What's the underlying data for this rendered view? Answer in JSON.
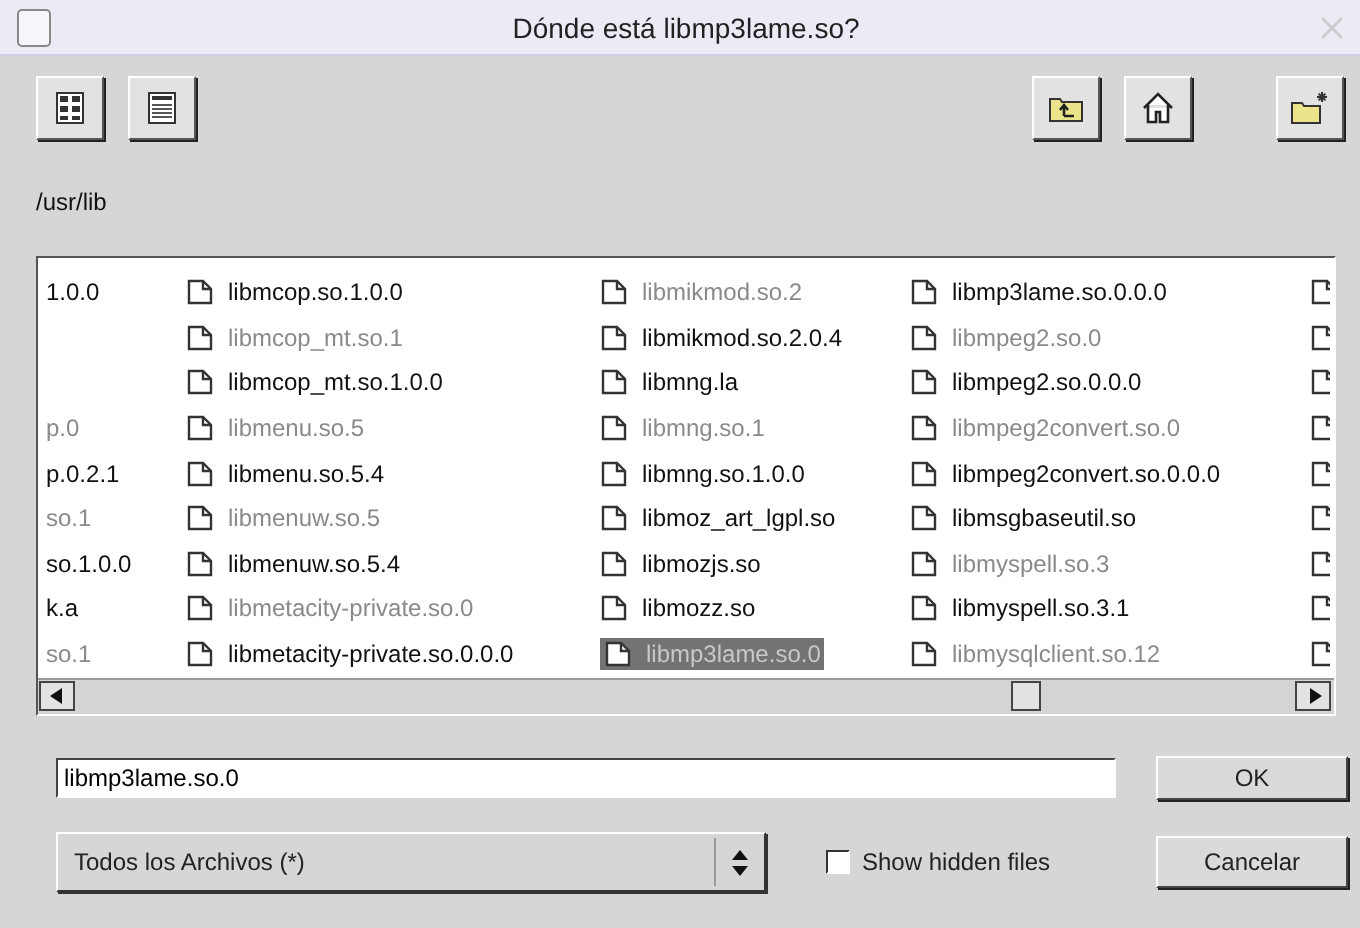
{
  "window": {
    "title": "Dónde está libmp3lame.so?"
  },
  "path": "/usr/lib",
  "file_columns": [
    {
      "items": [
        {
          "kind": "partial",
          "name": "1.0.0",
          "dim": false
        },
        {
          "kind": "blank"
        },
        {
          "kind": "blank"
        },
        {
          "kind": "partial",
          "name": "p.0",
          "dim": true
        },
        {
          "kind": "partial",
          "name": "p.0.2.1",
          "dim": false
        },
        {
          "kind": "partial",
          "name": "so.1",
          "dim": true
        },
        {
          "kind": "partial",
          "name": "so.1.0.0",
          "dim": false
        },
        {
          "kind": "partial",
          "name": "k.a",
          "dim": false
        },
        {
          "kind": "partial",
          "name": "so.1",
          "dim": true
        }
      ]
    },
    {
      "items": [
        {
          "kind": "file",
          "name": "libmcop.so.1.0.0",
          "dim": false,
          "selected": false
        },
        {
          "kind": "file",
          "name": "libmcop_mt.so.1",
          "dim": true,
          "selected": false
        },
        {
          "kind": "file",
          "name": "libmcop_mt.so.1.0.0",
          "dim": false,
          "selected": false
        },
        {
          "kind": "file",
          "name": "libmenu.so.5",
          "dim": true,
          "selected": false
        },
        {
          "kind": "file",
          "name": "libmenu.so.5.4",
          "dim": false,
          "selected": false
        },
        {
          "kind": "file",
          "name": "libmenuw.so.5",
          "dim": true,
          "selected": false
        },
        {
          "kind": "file",
          "name": "libmenuw.so.5.4",
          "dim": false,
          "selected": false
        },
        {
          "kind": "file",
          "name": "libmetacity-private.so.0",
          "dim": true,
          "selected": false
        },
        {
          "kind": "file",
          "name": "libmetacity-private.so.0.0.0",
          "dim": false,
          "selected": false
        }
      ]
    },
    {
      "items": [
        {
          "kind": "file",
          "name": "libmikmod.so.2",
          "dim": true,
          "selected": false
        },
        {
          "kind": "file",
          "name": "libmikmod.so.2.0.4",
          "dim": false,
          "selected": false
        },
        {
          "kind": "file",
          "name": "libmng.la",
          "dim": false,
          "selected": false
        },
        {
          "kind": "file",
          "name": "libmng.so.1",
          "dim": true,
          "selected": false
        },
        {
          "kind": "file",
          "name": "libmng.so.1.0.0",
          "dim": false,
          "selected": false
        },
        {
          "kind": "file",
          "name": "libmoz_art_lgpl.so",
          "dim": false,
          "selected": false
        },
        {
          "kind": "file",
          "name": "libmozjs.so",
          "dim": false,
          "selected": false
        },
        {
          "kind": "file",
          "name": "libmozz.so",
          "dim": false,
          "selected": false
        },
        {
          "kind": "file",
          "name": "libmp3lame.so.0",
          "dim": true,
          "selected": true
        }
      ]
    },
    {
      "items": [
        {
          "kind": "file",
          "name": "libmp3lame.so.0.0.0",
          "dim": false,
          "selected": false
        },
        {
          "kind": "file",
          "name": "libmpeg2.so.0",
          "dim": true,
          "selected": false
        },
        {
          "kind": "file",
          "name": "libmpeg2.so.0.0.0",
          "dim": false,
          "selected": false
        },
        {
          "kind": "file",
          "name": "libmpeg2convert.so.0",
          "dim": true,
          "selected": false
        },
        {
          "kind": "file",
          "name": "libmpeg2convert.so.0.0.0",
          "dim": false,
          "selected": false
        },
        {
          "kind": "file",
          "name": "libmsgbaseutil.so",
          "dim": false,
          "selected": false
        },
        {
          "kind": "file",
          "name": "libmyspell.so.3",
          "dim": true,
          "selected": false
        },
        {
          "kind": "file",
          "name": "libmyspell.so.3.1",
          "dim": false,
          "selected": false
        },
        {
          "kind": "file",
          "name": "libmysqlclient.so.12",
          "dim": true,
          "selected": false
        }
      ]
    },
    {
      "items": [
        {
          "kind": "icon"
        },
        {
          "kind": "icon"
        },
        {
          "kind": "icon"
        },
        {
          "kind": "icon"
        },
        {
          "kind": "icon"
        },
        {
          "kind": "icon"
        },
        {
          "kind": "icon"
        },
        {
          "kind": "icon"
        },
        {
          "kind": "icon"
        }
      ]
    }
  ],
  "filename": {
    "value": "libmp3lame.so.0"
  },
  "filter": {
    "value": "Todos los Archivos (*)"
  },
  "show_hidden": {
    "label": "Show hidden files",
    "checked": false
  },
  "buttons": {
    "ok": "OK",
    "cancel": "Cancelar"
  }
}
